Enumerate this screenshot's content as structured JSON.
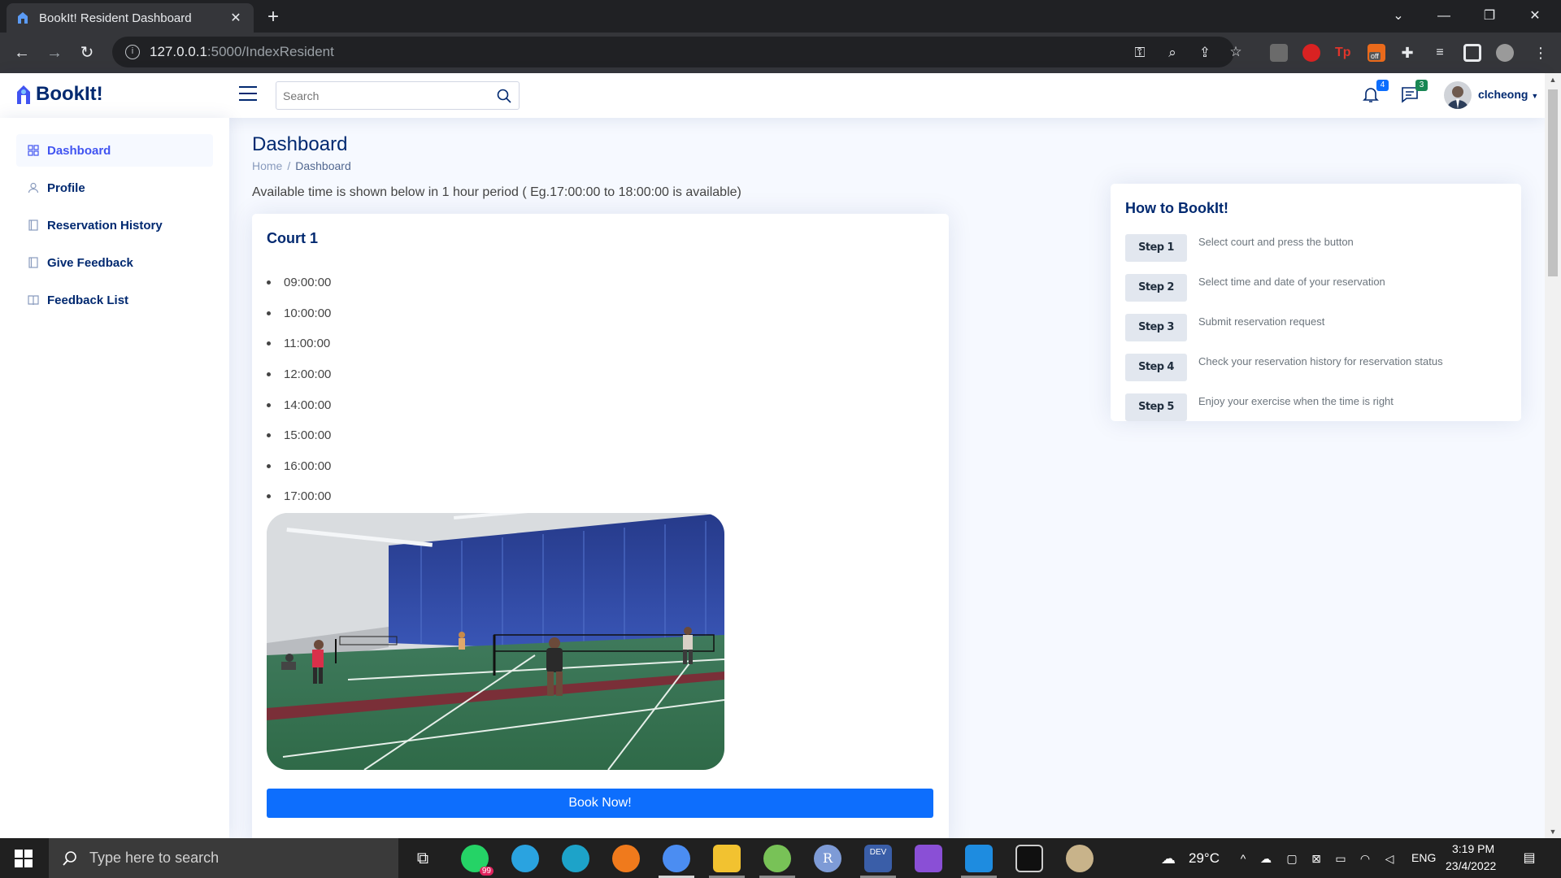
{
  "browser": {
    "tab_title": "BookIt! Resident Dashboard",
    "url_host": "127.0.0.1",
    "url_path": ":5000/IndexResident",
    "extension_badge": "off"
  },
  "header": {
    "brand": "BookIt!",
    "search_placeholder": "Search",
    "notifications_count": "4",
    "messages_count": "3",
    "username": "clcheong"
  },
  "sidebar": {
    "items": [
      {
        "label": "Dashboard",
        "icon": "grid-icon",
        "active": true
      },
      {
        "label": "Profile",
        "icon": "person-icon"
      },
      {
        "label": "Reservation History",
        "icon": "journal-icon"
      },
      {
        "label": "Give Feedback",
        "icon": "journal-icon"
      },
      {
        "label": "Feedback List",
        "icon": "book-icon"
      }
    ]
  },
  "page": {
    "title": "Dashboard",
    "breadcrumb": [
      "Home",
      "Dashboard"
    ],
    "availability_note": "Available time is shown below in 1 hour period ( Eg.17:00:00 to 18:00:00 is available)"
  },
  "court": {
    "name": "Court 1",
    "times": [
      "09:00:00",
      "10:00:00",
      "11:00:00",
      "12:00:00",
      "14:00:00",
      "15:00:00",
      "16:00:00",
      "17:00:00"
    ],
    "book_label": "Book Now!"
  },
  "howto": {
    "title": "How to BookIt!",
    "steps": [
      {
        "label": "Step 1",
        "text": "Select court and press the button"
      },
      {
        "label": "Step 2",
        "text": "Select time and date of your reservation"
      },
      {
        "label": "Step 3",
        "text": "Submit reservation request"
      },
      {
        "label": "Step 4",
        "text": "Check your reservation history for reservation status"
      },
      {
        "label": "Step 5",
        "text": "Enjoy your exercise when the time is right"
      }
    ]
  },
  "taskbar": {
    "search_placeholder": "Type here to search",
    "whatsapp_badge": "99",
    "temperature": "29°C",
    "language": "ENG",
    "time": "3:19 PM",
    "date": "23/4/2022"
  },
  "colors": {
    "brand": "#012970",
    "accent": "#4154f1",
    "button": "#0d6efd",
    "background": "#f6f9ff"
  }
}
